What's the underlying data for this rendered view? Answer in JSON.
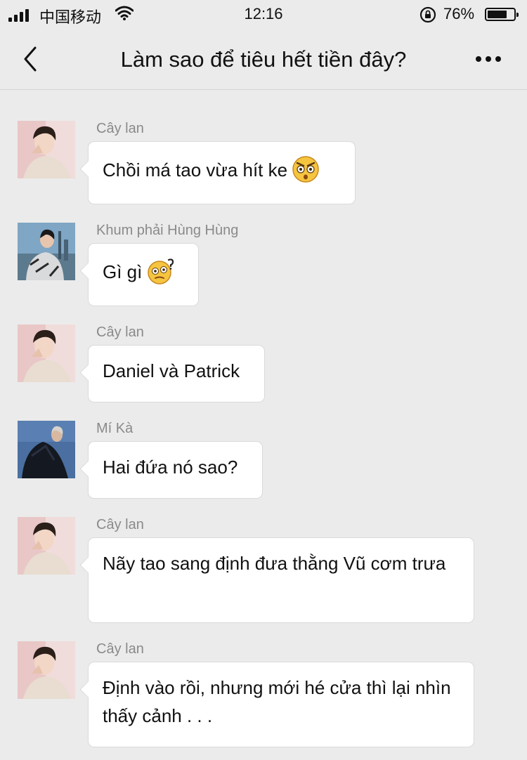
{
  "status_bar": {
    "carrier": "中国移动",
    "time": "12:16",
    "battery_percent": "76%",
    "battery_level": 0.76
  },
  "header": {
    "title": "Làm sao để tiêu hết tiền đây?"
  },
  "messages": [
    {
      "sender": "Cây lan",
      "text": "Chồi má tao vừa hít ke",
      "emoji": "angry-shocked-emoji"
    },
    {
      "sender": "Khum phải Hùng Hùng",
      "text": "Gì gì",
      "emoji": "confused-emoji"
    },
    {
      "sender": "Cây lan",
      "text": "Daniel và Patrick"
    },
    {
      "sender": "Mí Kà",
      "text": "Hai đứa nó sao?"
    },
    {
      "sender": "Cây lan",
      "text": "Nãy tao sang định đưa thằng Vũ cơm trưa"
    },
    {
      "sender": "Cây lan",
      "text": "Định vào rồi, nhưng mới hé cửa thì lại nhìn thấy cảnh . . ."
    }
  ],
  "colors": {
    "background": "#ebebeb",
    "bubble": "#ffffff",
    "sender_text": "#8a8a8a"
  }
}
